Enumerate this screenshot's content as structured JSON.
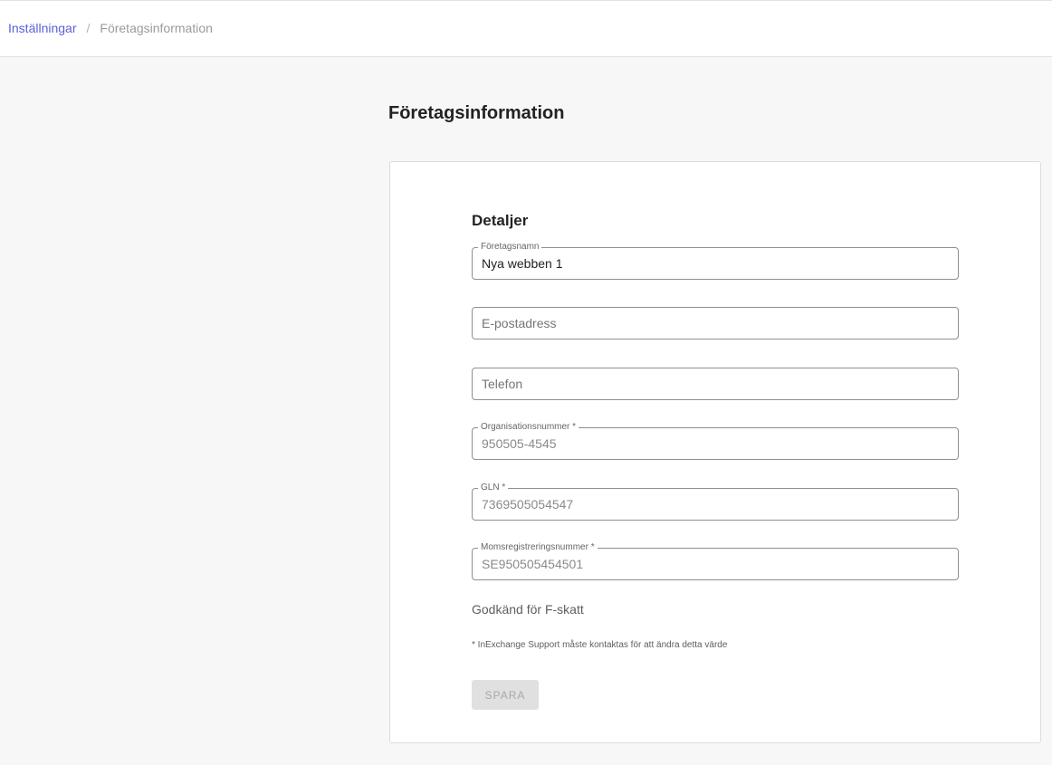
{
  "breadcrumb": {
    "parent": "Inställningar",
    "separator": "/",
    "current": "Företagsinformation"
  },
  "page": {
    "title": "Företagsinformation"
  },
  "form": {
    "section_title": "Detaljer",
    "company_name": {
      "label": "Företagsnamn",
      "value": "Nya webben 1"
    },
    "email": {
      "placeholder": "E-postadress",
      "value": ""
    },
    "phone": {
      "placeholder": "Telefon",
      "value": ""
    },
    "org_number": {
      "label": "Organisationsnummer *",
      "value": "950505-4545"
    },
    "gln": {
      "label": "GLN *",
      "value": "7369505054547"
    },
    "vat_number": {
      "label": "Momsregistreringsnummer *",
      "value": "SE950505454501"
    },
    "fskatt_label": "Godkänd för F-skatt",
    "note": "* InExchange Support måste kontaktas för att ändra detta värde",
    "save_label": "SPARA"
  },
  "colors": {
    "link": "#5a5fd6",
    "background": "#f7f7f7",
    "card": "#ffffff",
    "disabled_button": "#e0e0e0"
  }
}
